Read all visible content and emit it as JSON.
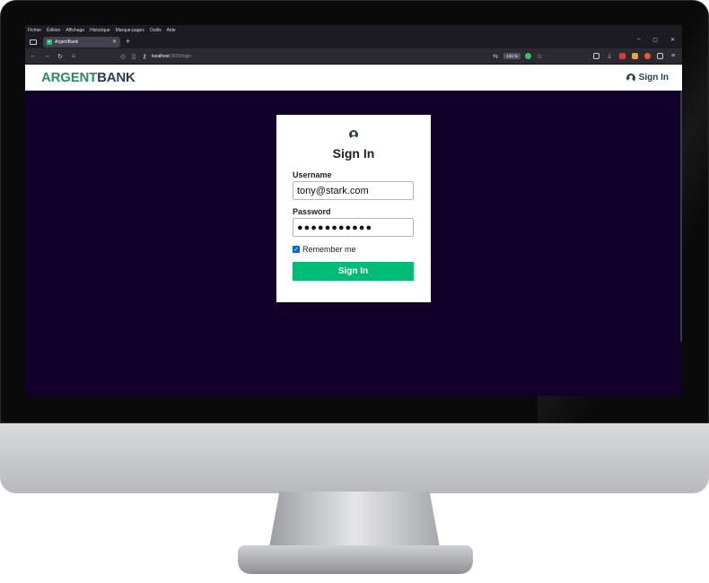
{
  "browser": {
    "menu": [
      "Fichier",
      "Édition",
      "Affichage",
      "Historique",
      "Marque-pages",
      "Outils",
      "Aide"
    ],
    "tab": {
      "title": "ArgentBank",
      "close": "✕"
    },
    "new_tab": "+",
    "window_controls": [
      "–",
      "▢",
      "✕"
    ],
    "url": {
      "host": "localhost",
      "path": ":3000/login"
    },
    "zoom": "133 %",
    "icons": {
      "back": "arrow-left-icon",
      "forward": "arrow-right-icon",
      "reload": "reload-icon",
      "home": "home-icon",
      "shield": "shield-icon",
      "page": "page-icon",
      "key": "key-icon",
      "translate": "translate-icon",
      "bookmark": "star-icon",
      "pocket": "pocket-icon",
      "downloads": "download-icon",
      "menu": "hamburger-icon"
    }
  },
  "site": {
    "logo_part1": "ARGENT",
    "logo_part2": "BANK",
    "nav_signin": "Sign In",
    "colors": {
      "primary": "#00bc77",
      "logo_green": "#2c8c5f",
      "dark_text": "#2c3e50",
      "background": "#12002b"
    }
  },
  "form": {
    "title": "Sign In",
    "username_label": "Username",
    "username_value": "tony@stark.com",
    "password_label": "Password",
    "password_value": "●●●●●●●●●●●",
    "remember_label": "Remember me",
    "remember_checked": true,
    "submit_label": "Sign In"
  }
}
